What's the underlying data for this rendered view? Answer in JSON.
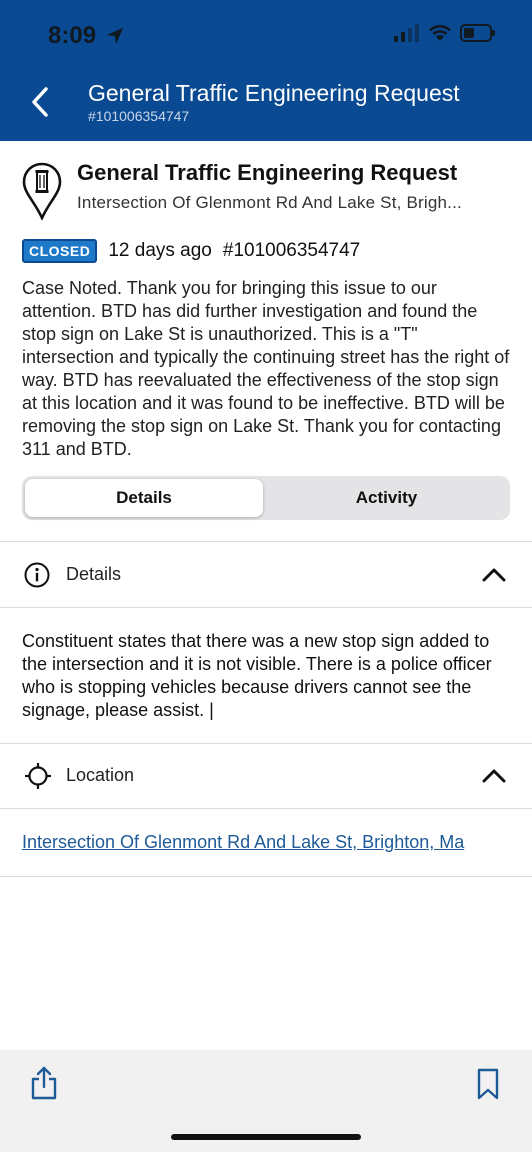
{
  "status_bar": {
    "time": "8:09",
    "icons": [
      "location-arrow-icon",
      "cellular-signal-icon",
      "wifi-icon",
      "battery-icon"
    ]
  },
  "nav": {
    "title": "General Traffic Engineering Request",
    "subtitle": "#101006354747"
  },
  "case": {
    "title": "General Traffic Engineering Request",
    "address": "Intersection Of Glenmont Rd And Lake St, Brigh...",
    "status_badge": "CLOSED",
    "age": "12 days ago",
    "id": "#101006354747",
    "closure_note": "Case Noted. Thank you for bringing this issue to our attention. BTD has did further investigation and found the stop sign on Lake St is unauthorized. This is a \"T\" intersection and typically the continuing street has the right of way.  BTD has reevaluated the effectiveness of the stop sign at this location and it was found to be ineffective. BTD will be removing the stop sign on Lake St. Thank you for contacting 311 and BTD."
  },
  "tabs": {
    "details": "Details",
    "activity": "Activity",
    "selected": "Details"
  },
  "details_section": {
    "label": "Details",
    "text": "Constituent states that there was a new stop sign added to the intersection and it is not visible. There is a police officer who is stopping vehicles because drivers cannot see the signage, please assist. |"
  },
  "location_section": {
    "label": "Location",
    "link": "Intersection Of Glenmont Rd And Lake St, Brighton, Ma"
  },
  "colors": {
    "header_bg": "#0a4a93",
    "badge_bg": "#1e7ac8",
    "link": "#1d5a96"
  }
}
